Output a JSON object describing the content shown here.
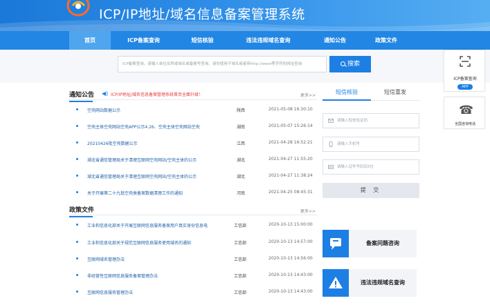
{
  "header": {
    "title": "ICP/IP地址/域名信息备案管理系统"
  },
  "nav": {
    "items": [
      {
        "label": "首页",
        "active": true
      },
      {
        "label": "ICP备案查询",
        "active": false
      },
      {
        "label": "短信核验",
        "active": false
      },
      {
        "label": "违法违规域名查询",
        "active": false
      },
      {
        "label": "通知公告",
        "active": false
      },
      {
        "label": "政策文件",
        "active": false
      }
    ]
  },
  "search": {
    "placeholder": "ICP备案查询，请输入单位名称或域名或备案号查询，请勿使用子域名或者带http://www等字符的网址查询",
    "button_label": "搜索"
  },
  "float_app": {
    "label": "ICP备案查询",
    "badge": "APP"
  },
  "float_phone": {
    "label": "全国咨询电话"
  },
  "notice": {
    "title": "通知公告",
    "announcement": "ICP/IP地址/域名信息备案管理系统首页全面升级！",
    "more": "更多>>",
    "rows": [
      {
        "title": "空壳网站数据公示",
        "region": "陕西",
        "date": "2021-05-08 16:30:10"
      },
      {
        "title": "空壳主体空壳网站空壳APP公示4.26、空壳主体空壳网站空壳",
        "region": "湖南",
        "date": "2021-05-07 15:26:14"
      },
      {
        "title": "20210426批空壳数据公示",
        "region": "江西",
        "date": "2021-04-28 16:52:21"
      },
      {
        "title": "湖北省通信管理局关于清理互联网空壳网站/空壳主体的公示",
        "region": "湖北",
        "date": "2021-04-27 11:55:20"
      },
      {
        "title": "湖北省通信管理局关于清理互联网空壳网站/空壳主体的公示",
        "region": "湖北",
        "date": "2021-04-27 11:38:24"
      },
      {
        "title": "关于开展第二十九批空壳类备案数据清理工作的通知",
        "region": "河南",
        "date": "2021-04-25 08:45:31"
      }
    ]
  },
  "policy": {
    "title": "政策文件",
    "more": "更多>>",
    "rows": [
      {
        "title": "工业和信息化部关于开展互联网信息服务备案用户真实身份信息电",
        "region": "工信部",
        "date": "2020-10-13 15:00:00"
      },
      {
        "title": "工业和信息化部关于规范互联网信息服务使用域名的通知",
        "region": "工信部",
        "date": "2020-10-13 14:57:00"
      },
      {
        "title": "互联网域名管理办法",
        "region": "工信部",
        "date": "2020-10-13 14:56:00"
      },
      {
        "title": "非经营性互联网信息服务备案管理办法",
        "region": "工信部",
        "date": "2020-10-13 14:43:00"
      },
      {
        "title": "互联网信息服务管理办法",
        "region": "工信部",
        "date": "2020-10-13 14:43:00"
      }
    ]
  },
  "sms": {
    "tab_active": "短信核验",
    "tab_inactive": "短信重发",
    "fields": [
      {
        "placeholder": "请输入短信验证码",
        "icon": "mail-icon"
      },
      {
        "placeholder": "请输入手机号",
        "icon": "phone-icon"
      },
      {
        "placeholder": "请输入证件号码后6位",
        "icon": "id-card-icon"
      }
    ],
    "submit_label": "提 交"
  },
  "side_cards": {
    "consult": "备案问题咨询",
    "illegal": "违法违规域名查询"
  },
  "colors": {
    "primary": "#1d7fe3",
    "nav_bg": "#2286e4",
    "nav_active": "#4fa6ef",
    "alert_text": "#e53935"
  }
}
